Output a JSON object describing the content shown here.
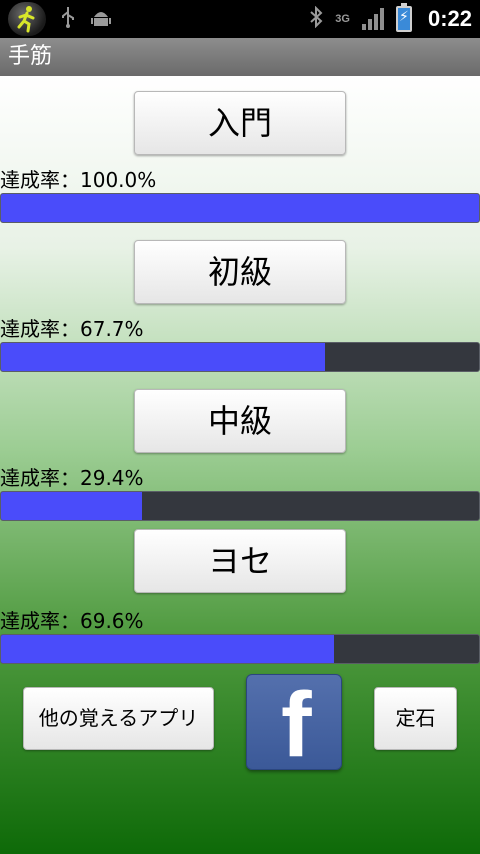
{
  "status_bar": {
    "time": "0:22",
    "network": "3G"
  },
  "title_bar": {
    "title": "手筋"
  },
  "levels": [
    {
      "label": "入門",
      "rate_text": "達成率：100.0%",
      "rate": 1.0
    },
    {
      "label": "初級",
      "rate_text": "達成率：67.7%",
      "rate": 0.677
    },
    {
      "label": "中級",
      "rate_text": "達成率：29.4%",
      "rate": 0.294
    },
    {
      "label": "ヨセ",
      "rate_text": "達成率：69.6%",
      "rate": 0.696
    }
  ],
  "footer": {
    "other_apps_label": "他の覚えるアプリ",
    "facebook_icon": "facebook-icon",
    "joseki_label": "定石"
  },
  "colors": {
    "progress_fill": "#4a4cfa",
    "progress_track": "#34373e",
    "facebook_blue": "#3b5998"
  }
}
